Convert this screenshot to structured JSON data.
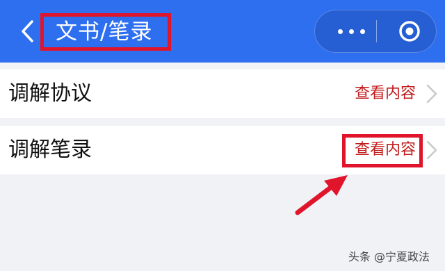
{
  "header": {
    "back_icon": "chevron-left-icon",
    "title": "文书/笔录",
    "more_icon": "more-dots-icon",
    "close_icon": "target-circle-icon"
  },
  "rows": [
    {
      "label": "调解协议",
      "action": "查看内容"
    },
    {
      "label": "调解笔录",
      "action": "查看内容"
    }
  ],
  "annotations": {
    "highlight_color": "#e0142b",
    "arrow_color": "#e0142b"
  },
  "colors": {
    "header_bg": "#2e6ff0",
    "action_text": "#c21c1c",
    "page_bg": "#f1f2f6"
  },
  "watermark": "头条 @宁夏政法"
}
